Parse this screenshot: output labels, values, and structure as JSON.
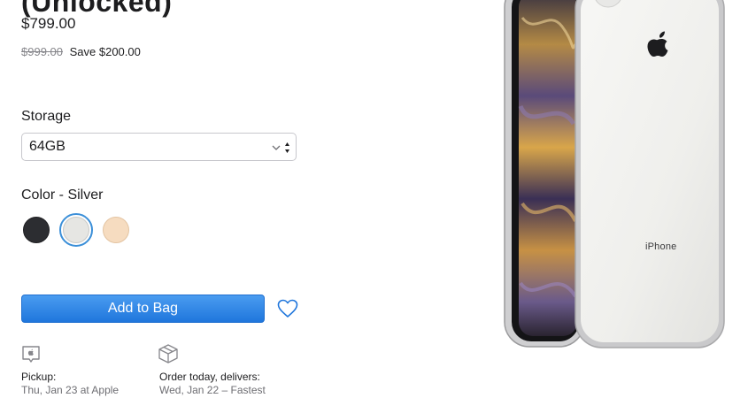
{
  "product": {
    "title": "(Unlocked)",
    "price": "$799.00",
    "original_price": "$999.00",
    "savings": "Save $200.00"
  },
  "storage": {
    "label": "Storage",
    "selected": "64GB"
  },
  "color": {
    "label": "Color - Silver",
    "swatches": [
      {
        "name": "Space Gray",
        "hex": "#2c2d31",
        "selected": false
      },
      {
        "name": "Silver",
        "hex": "#e6e6e3",
        "selected": true
      },
      {
        "name": "Gold",
        "hex": "#f6dcc0",
        "selected": false
      }
    ]
  },
  "actions": {
    "add_to_bag": "Add to Bag",
    "favorite_icon": "heart-icon"
  },
  "fulfillment": {
    "pickup": {
      "icon": "apple-store-icon",
      "head": "Pickup:",
      "sub": "Thu, Jan 23 at Apple"
    },
    "delivery": {
      "icon": "box-icon",
      "head": "Order today, delivers:",
      "sub": "Wed, Jan 22 – Fastest"
    }
  },
  "image": {
    "brand_text": "iPhone"
  },
  "colors": {
    "accent": "#0071e3",
    "button_top": "#4a9cf0",
    "button_bottom": "#1f76dc"
  }
}
